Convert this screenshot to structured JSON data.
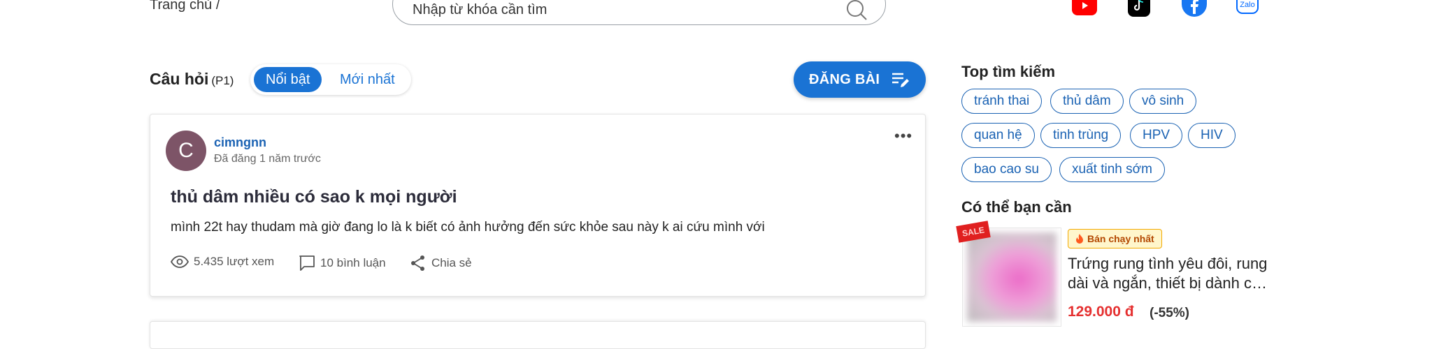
{
  "breadcrumb": "Trang chủ /",
  "search": {
    "placeholder": "Nhập từ khóa cần tìm"
  },
  "social": [
    "youtube-icon",
    "tiktok-icon",
    "facebook-icon",
    "zalo-icon"
  ],
  "zalo_label": "Zalo",
  "questions": {
    "title": "Câu hỏi",
    "page": "(P1)",
    "tabs": [
      {
        "label": "Nổi bật",
        "active": true
      },
      {
        "label": "Mới nhất",
        "active": false
      }
    ],
    "post_button": "ĐĂNG BÀI"
  },
  "post": {
    "avatar_letter": "C",
    "author": "cimngnn",
    "time": "Đã đăng 1 năm trước",
    "more": "•••",
    "title": "thủ dâm nhiều có sao k mọi người",
    "body": "mình 22t hay thudam mà giờ đang lo là k biết có ảnh hưởng đến sức khỏe sau này k ai cứu mình với",
    "views": "5.435 lượt xem",
    "comments": "10 bình luận",
    "share": "Chia sẻ"
  },
  "top_search": {
    "title": "Top tìm kiếm",
    "tags": [
      "tránh thai",
      "thủ dâm",
      "vô sinh",
      "quan hệ",
      "tinh trùng",
      "HPV",
      "HIV",
      "bao cao su",
      "xuất tinh sớm"
    ]
  },
  "suggest": {
    "title": "Có thể bạn cần",
    "sale_tag": "SALE",
    "badge": "Bán chạy nhất",
    "name": "Trứng rung tình yêu đôi, rung dài và ngắn, thiết bị dành c…",
    "price": "129.000 đ",
    "discount": "(-55%)"
  },
  "colors": {
    "primary": "#1a73d4",
    "link": "#1a62b3",
    "price": "#e53030",
    "avatar": "#7d5467"
  }
}
